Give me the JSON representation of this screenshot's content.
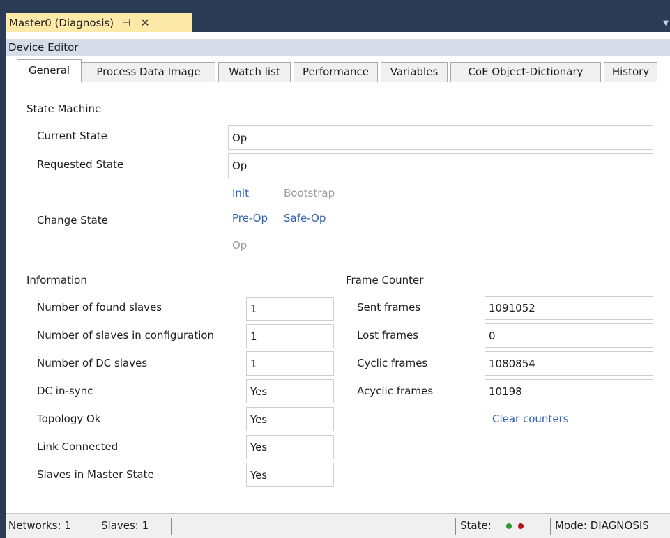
{
  "document_tab": {
    "title": "Master0 (Diagnosis)",
    "pin_glyph": "⊣",
    "close_glyph": "✕"
  },
  "editor": {
    "title": "Device Editor"
  },
  "tabs": [
    {
      "label": "General",
      "active": true
    },
    {
      "label": "Process Data Image"
    },
    {
      "label": "Watch list"
    },
    {
      "label": "Performance"
    },
    {
      "label": "Variables"
    },
    {
      "label": "CoE Object-Dictionary"
    },
    {
      "label": "History"
    }
  ],
  "state_machine": {
    "heading": "State Machine",
    "current_state_label": "Current State",
    "current_state": "Op",
    "requested_state_label": "Requested State",
    "requested_state": "Op",
    "change_state_label": "Change State",
    "buttons": {
      "init": "Init",
      "bootstrap": "Bootstrap",
      "preop": "Pre-Op",
      "safeop": "Safe-Op",
      "op": "Op"
    }
  },
  "information": {
    "heading": "Information",
    "rows": [
      {
        "label": "Number of found slaves",
        "value": "1"
      },
      {
        "label": "Number of slaves in configuration",
        "value": "1"
      },
      {
        "label": "Number of DC slaves",
        "value": "1"
      },
      {
        "label": "DC in-sync",
        "value": "Yes"
      },
      {
        "label": "Topology Ok",
        "value": "Yes"
      },
      {
        "label": "Link Connected",
        "value": "Yes"
      },
      {
        "label": "Slaves in Master State",
        "value": "Yes"
      }
    ]
  },
  "frame_counter": {
    "heading": "Frame Counter",
    "rows": [
      {
        "label": "Sent frames",
        "value": "1091052"
      },
      {
        "label": "Lost frames",
        "value": "0"
      },
      {
        "label": "Cyclic frames",
        "value": "1080854"
      },
      {
        "label": "Acyclic frames",
        "value": "10198"
      }
    ],
    "clear_label": "Clear counters"
  },
  "status_bar": {
    "networks": "Networks: 1",
    "slaves": "Slaves: 1",
    "state_label": "State:",
    "led_colors": [
      "#2e9b2e",
      "#b01818"
    ],
    "mode": "Mode: DIAGNOSIS"
  }
}
